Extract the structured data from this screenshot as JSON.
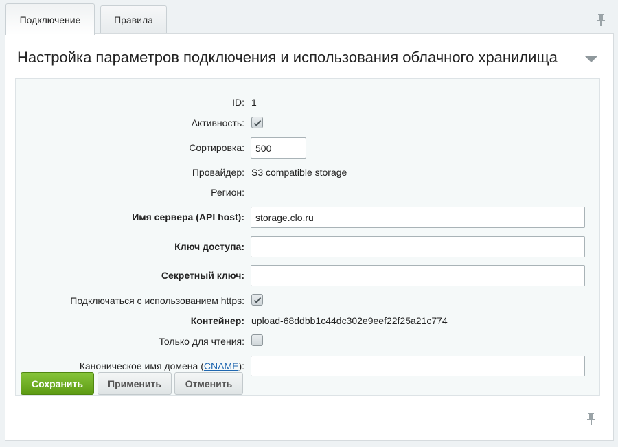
{
  "tabs": [
    {
      "label": "Подключение",
      "active": true
    },
    {
      "label": "Правила",
      "active": false
    }
  ],
  "panel": {
    "title": "Настройка параметров подключения и использования облачного хранилища"
  },
  "form": {
    "id": {
      "label": "ID:",
      "value": "1"
    },
    "active": {
      "label": "Активность:",
      "checked": true
    },
    "sort": {
      "label": "Сортировка:",
      "value": "500"
    },
    "provider": {
      "label": "Провайдер:",
      "value": "S3 compatible storage"
    },
    "region": {
      "label": "Регион:",
      "value": ""
    },
    "host": {
      "label": "Имя сервера (API host):",
      "value": "storage.clo.ru"
    },
    "access_key": {
      "label": "Ключ доступа:",
      "value": ""
    },
    "secret_key": {
      "label": "Секретный ключ:",
      "value": ""
    },
    "https": {
      "label": "Подключаться с использованием https:",
      "checked": true
    },
    "container": {
      "label": "Контейнер:",
      "value": "upload-68ddbb1c44dc302e9eef22f25a21c774"
    },
    "readonly": {
      "label": "Только для чтения:",
      "checked": false
    },
    "cname": {
      "label_prefix": "Каноническое имя домена (",
      "label_link": "CNAME",
      "label_suffix": "):",
      "value": ""
    }
  },
  "buttons": {
    "save": "Сохранить",
    "apply": "Применить",
    "cancel": "Отменить"
  },
  "icons": {
    "pin_top": "pin-icon",
    "pin_bottom": "pin-icon",
    "collapse": "chevron-down-icon",
    "check": "checkmark-icon"
  },
  "colors": {
    "primary_button": "#6aaa1c",
    "link": "#2067b0",
    "panel_bg": "#f5f9f9"
  }
}
